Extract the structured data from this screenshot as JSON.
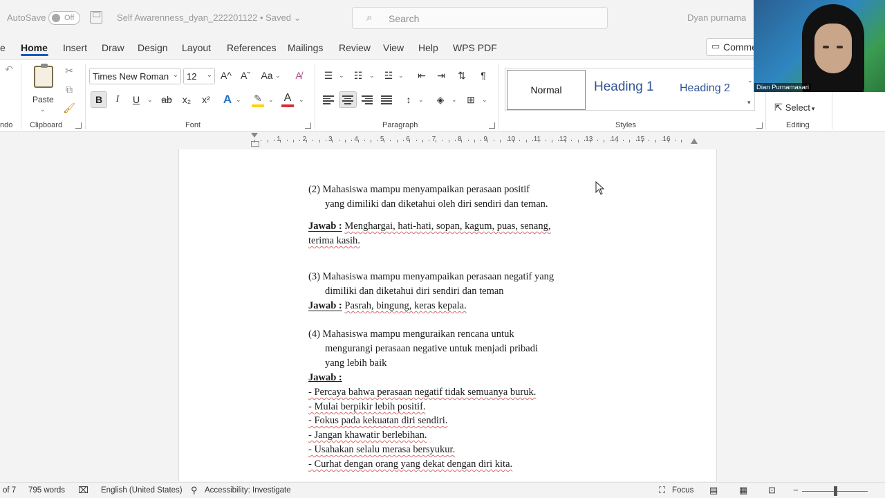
{
  "titlebar": {
    "autosave_label": "AutoSave",
    "autosave_state": "Off",
    "doc_title": "Self Awarenness_dyan_222201122 • Saved ⌄",
    "search_placeholder": "Search",
    "user_name": "Dyan purnama"
  },
  "tabs": [
    "Home",
    "Insert",
    "Draw",
    "Design",
    "Layout",
    "References",
    "Mailings",
    "Review",
    "View",
    "Help",
    "WPS PDF"
  ],
  "left_cut": {
    "tab": "e",
    "group": "ndo"
  },
  "comments_label": "Comments",
  "ribbon": {
    "clipboard": {
      "paste": "Paste",
      "label": "Clipboard"
    },
    "font": {
      "family": "Times New Roman",
      "size": "12",
      "grow": "A^",
      "shrink": "Aˇ",
      "case": "Aa",
      "bold": "B",
      "italic": "I",
      "underline": "U",
      "strike": "ab",
      "subscript": "x₂",
      "superscript": "x²",
      "effects": "A",
      "color": "A",
      "label": "Font"
    },
    "paragraph": {
      "pilcrow": "¶",
      "label": "Paragraph"
    },
    "styles": {
      "normal": "Normal",
      "heading1": "Heading 1",
      "heading2": "Heading 2",
      "label": "Styles"
    },
    "editing": {
      "select": "Select",
      "label": "Editing"
    }
  },
  "ruler": {
    "numbers": [
      "1",
      "2",
      "3",
      "4",
      "5",
      "6",
      "7",
      "8",
      "9",
      "10",
      "11",
      "12",
      "13",
      "14",
      "15",
      "16"
    ]
  },
  "document": {
    "item2_num": "(2)",
    "item2_line1": "Mahasiswa  mampu  menyampaikan  perasaan  positif",
    "item2_line2": "yang  dimiliki  dan diketahui oleh diri sendiri dan teman.",
    "jawab": "Jawab :",
    "answer2_line1": "Menghargai, hati-hati, sopan, kagum, puas, senang,",
    "answer2_line2": "terima kasih.",
    "item3_num": "(3)",
    "item3_line1": "Mahasiswa mampu menyampaikan perasaan negatif yang",
    "item3_line2": "dimiliki dan diketahui diri sendiri dan teman",
    "answer3": "Pasrah, bingung, keras kepala.",
    "item4_num": "(4)",
    "item4_line1": "Mahasiswa  mampu  menguraikan  rencana  untuk",
    "item4_line2": "mengurangi  perasaan  negative untuk menjadi pribadi",
    "item4_line3": "yang lebih baik",
    "bullets": [
      "- Percaya bahwa perasaan negatif tidak semuanya buruk.",
      "- Mulai berpikir lebih positif.",
      "- Fokus pada kekuatan diri sendiri.",
      "- Jangan khawatir berlebihan.",
      "- Usahakan selalu merasa bersyukur.",
      "- Curhat dengan orang yang dekat dengan diri kita."
    ]
  },
  "statusbar": {
    "pages": "of 7",
    "words": "795 words",
    "language": "English (United States)",
    "accessibility": "Accessibility: Investigate",
    "focus": "Focus"
  },
  "webcam": {
    "name": "Dian Purnamasari"
  },
  "colors": {
    "accent": "#185abd",
    "heading": "#2f5496",
    "highlight": "#ffd400",
    "font_color": "#d13438"
  }
}
